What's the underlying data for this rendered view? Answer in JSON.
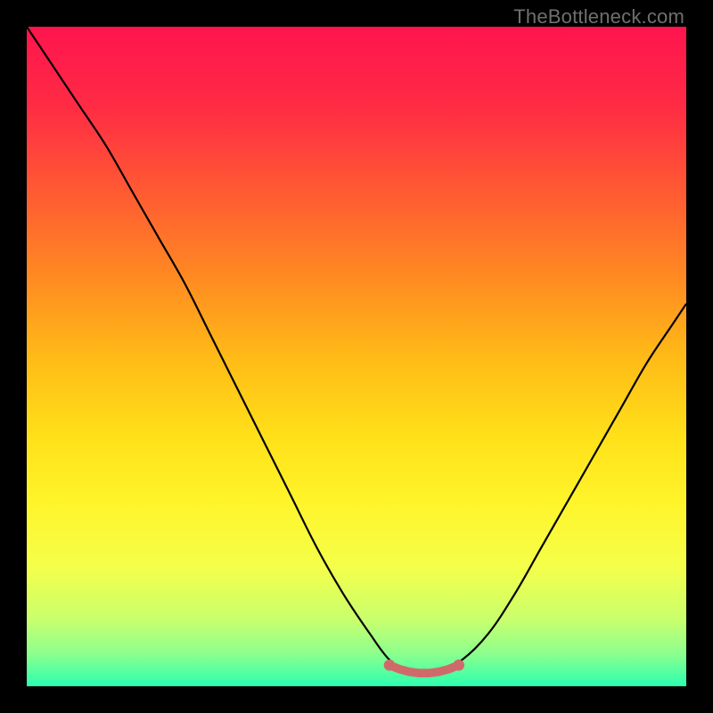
{
  "attribution": "TheBottleneck.com",
  "chart_data": {
    "type": "line",
    "title": "",
    "xlabel": "",
    "ylabel": "",
    "xlim": [
      0,
      100
    ],
    "ylim": [
      0,
      100
    ],
    "grid": false,
    "legend": false,
    "background": {
      "gradient_direction": "vertical",
      "stops": [
        {
          "pos": 0.0,
          "color": "#ff144e"
        },
        {
          "pos": 0.12,
          "color": "#ff2b44"
        },
        {
          "pos": 0.25,
          "color": "#ff5a33"
        },
        {
          "pos": 0.38,
          "color": "#ff8a22"
        },
        {
          "pos": 0.5,
          "color": "#ffba17"
        },
        {
          "pos": 0.62,
          "color": "#ffe019"
        },
        {
          "pos": 0.72,
          "color": "#fff42a"
        },
        {
          "pos": 0.82,
          "color": "#f4ff4a"
        },
        {
          "pos": 0.9,
          "color": "#c8ff6e"
        },
        {
          "pos": 0.95,
          "color": "#8dff8d"
        },
        {
          "pos": 1.0,
          "color": "#2bffb0"
        }
      ]
    },
    "series": [
      {
        "name": "bottleneck-curve",
        "stroke": "#000000",
        "x": [
          0,
          4,
          8,
          12,
          16,
          20,
          24,
          28,
          32,
          36,
          40,
          44,
          48,
          52,
          55,
          58,
          60,
          62,
          66,
          70,
          74,
          78,
          82,
          86,
          90,
          94,
          98,
          100
        ],
        "y": [
          100,
          94,
          88,
          82,
          75,
          68,
          61,
          53,
          45,
          37,
          29,
          21,
          14,
          8,
          4,
          2,
          2,
          2,
          4,
          8,
          14,
          21,
          28,
          35,
          42,
          49,
          55,
          58
        ]
      }
    ],
    "markers": [
      {
        "name": "optimal-band",
        "color": "#d06a6a",
        "x": [
          55,
          56.5,
          58,
          59.5,
          61,
          62.5,
          64,
          65.5
        ],
        "y": [
          3.2,
          2.6,
          2.2,
          2.0,
          2.0,
          2.2,
          2.6,
          3.2
        ],
        "r": 6
      }
    ]
  }
}
